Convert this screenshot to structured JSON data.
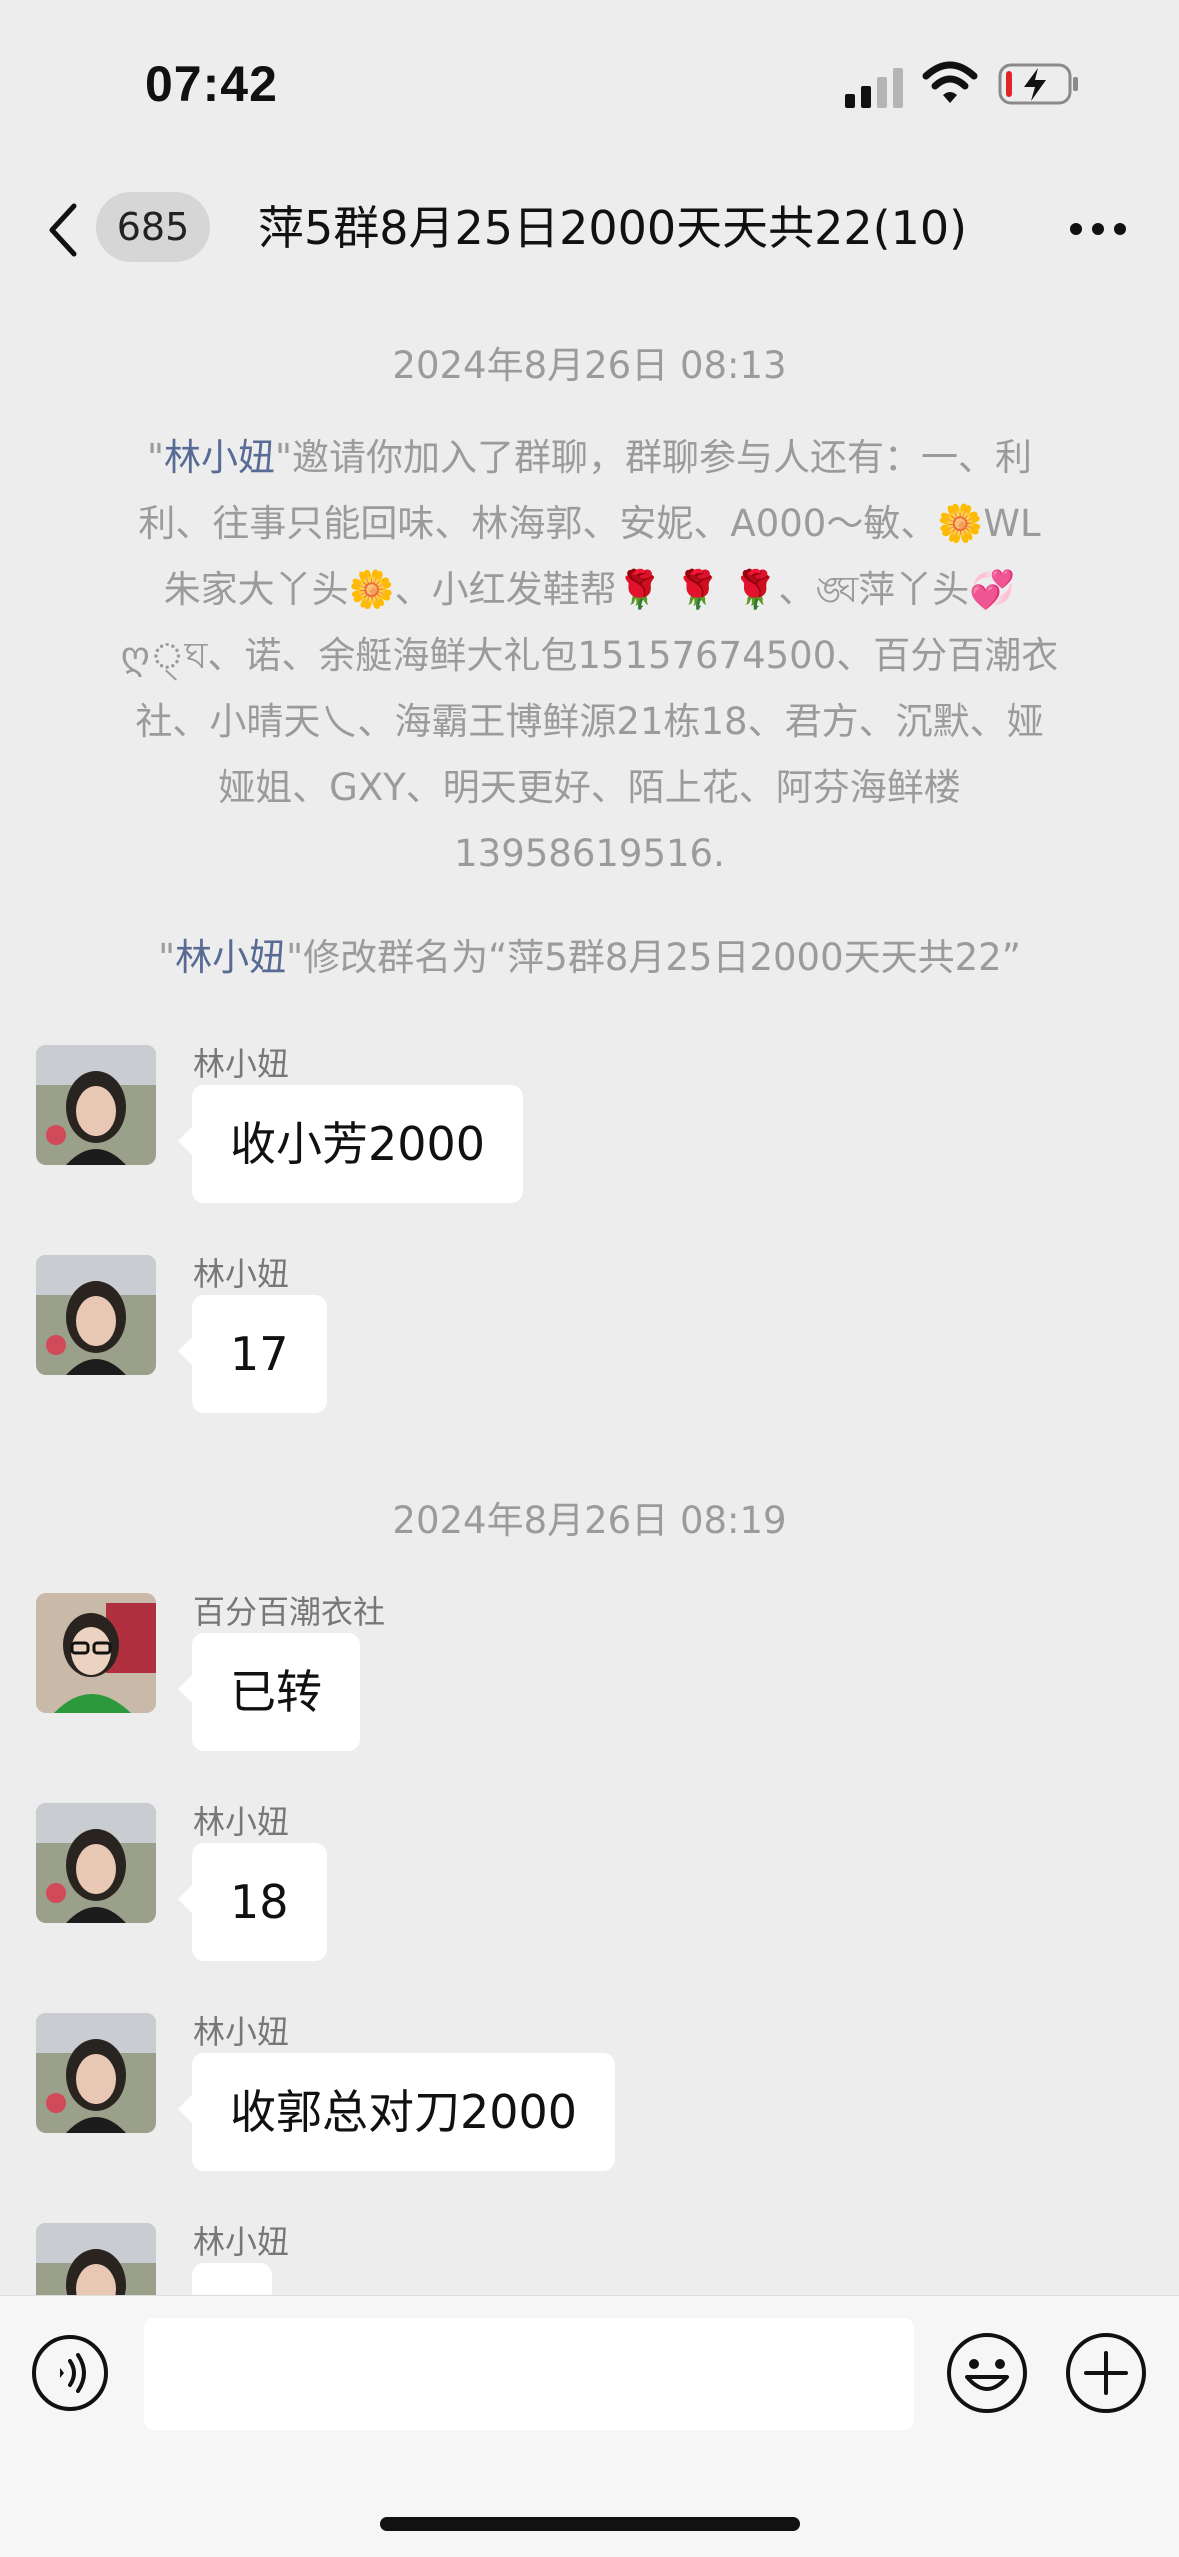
{
  "status_bar": {
    "time": "07:42"
  },
  "nav": {
    "unread_count": "685",
    "title": "萍5群8月25日2000天天共22(10)"
  },
  "system_messages": [
    {
      "type": "timestamp",
      "text": "2024年8月26日 08:13"
    },
    {
      "type": "invite",
      "name": "林小妞",
      "lines": [
        "\"林小妞\"邀请你加入了群聊，群聊参与人还有：一、利",
        "利、往事只能回味、林海郭、安妮、A000～敏、🌼WL",
        "朱家大丫头🌼、小红发鞋帮🌹 🌹 🌹、ঙ্ঘ萍丫头💞",
        "ღ্ঘ、诺、余艇海鲜大礼包15157674500、百分百潮衣",
        "社、小晴天乀、海霸王博鲜源21栋18、君方、沉默、娅",
        "娅姐、GXY、明天更好、陌上花、阿芬海鲜楼",
        "13958619516."
      ]
    },
    {
      "type": "rename",
      "name": "林小妞",
      "text": "\"林小妞\"修改群名为“萍5群8月25日2000天天共22”"
    },
    {
      "type": "timestamp",
      "text": "2024年8月26日 08:19"
    }
  ],
  "messages": [
    {
      "sender": "林小妞",
      "text": "收小芳2000"
    },
    {
      "sender": "林小妞",
      "text": "17"
    },
    {
      "sender": "百分百潮衣社",
      "text": "已转"
    },
    {
      "sender": "林小妞",
      "text": "18"
    },
    {
      "sender": "林小妞",
      "text": "收郭总对刀2000"
    },
    {
      "sender": "林小妞",
      "text": ""
    }
  ],
  "colors": {
    "background": "#ededed",
    "bubble": "#ffffff",
    "name_link": "#576b95",
    "system_text": "#9b9b9b",
    "input_bar": "#f6f6f6"
  },
  "icons": [
    "back-icon",
    "more-icon",
    "voice-icon",
    "emoji-icon",
    "plus-icon",
    "signal-icon",
    "wifi-icon",
    "battery-icon"
  ]
}
